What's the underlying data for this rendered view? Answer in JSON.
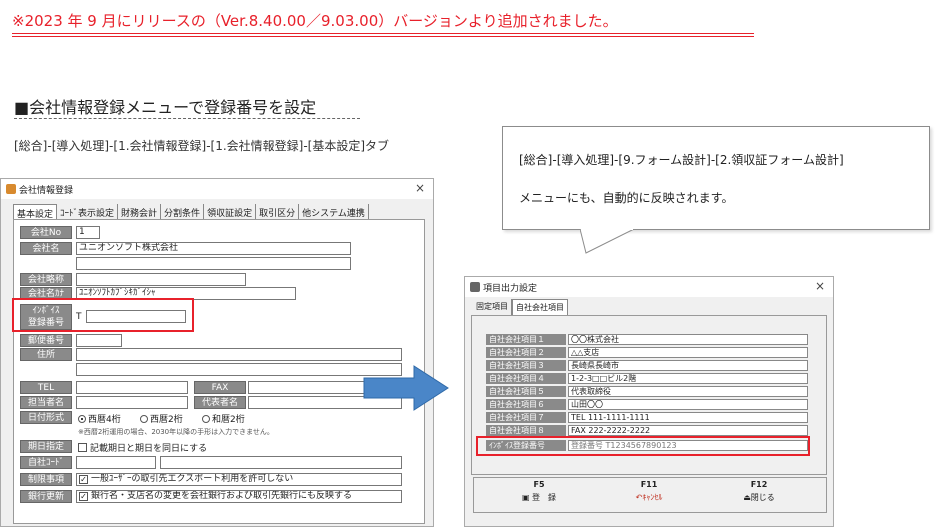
{
  "notice": "※2023 年 9 月にリリースの（Ver.8.40.00／9.03.00）バージョンより追加されました。",
  "section_title": "■会社情報登録メニューで登録番号を設定",
  "menu_path": "[総合]-[導入処理]-[1.会社情報登録]-[1.会社情報登録]-[基本設定]タブ",
  "callout": {
    "line1": "[総合]-[導入処理]-[9.フォーム設計]-[2.領収証フォーム設計]",
    "line2": "メニューにも、自動的に反映されます。"
  },
  "colors": {
    "notice_red": "#e8212b",
    "arrow_blue": "#4a86c8",
    "label_gray": "#8a8a8a"
  },
  "dialog1": {
    "title": "会社情報登録",
    "close": "×",
    "tabs": [
      "基本設定",
      "ｺｰﾄﾞ表示設定",
      "財務会計",
      "分割条件",
      "領収証設定",
      "取引区分",
      "他システム連携"
    ],
    "labels": {
      "company_no": "会社No",
      "company_name": "会社名",
      "company_short": "会社略称",
      "company_kana": "会社名ｶﾅ",
      "invoice_line1": "ｲﾝﾎﾞｲｽ",
      "invoice_line2": "登録番号",
      "postal": "郵便番号",
      "address": "住所",
      "tel": "TEL",
      "fax": "FAX",
      "contact_name": "担当者名",
      "representative": "代表者名",
      "date_format": "日付形式",
      "fiscal_date": "期日指定",
      "own_code": "自社ｺｰﾄﾞ",
      "restriction": "制限事項",
      "bank_update": "銀行更新"
    },
    "values": {
      "company_no": "1",
      "company_name": "ユニオンソフト株式会社",
      "company_kana": "ﾕﾆｵﾝｿﾌﾄｶﾌﾞｼｷｶﾞｲｼｬ",
      "invoice_prefix": "T",
      "date_opt1": "西暦4桁",
      "date_opt2": "西暦2桁",
      "date_opt3": "和暦2桁",
      "date_note": "※西暦2桁運用の場合、2030年以降の手形は入力できません。",
      "fiscal_check": "記載期日と期日を同日にする",
      "restriction_check": "一般ﾕｰｻﾞｰの取引先エクスポート利用を許可しない",
      "bank_check": "銀行名・支店名の変更を会社銀行および取引先銀行にも反映する"
    }
  },
  "dialog2": {
    "title": "項目出力設定",
    "close": "×",
    "tabs": [
      "固定項目",
      "自社会社項目"
    ],
    "rows": [
      {
        "label": "自社会社項目１",
        "value": "〇〇株式会社"
      },
      {
        "label": "自社会社項目２",
        "value": "△△支店"
      },
      {
        "label": "自社会社項目３",
        "value": "長崎県長崎市"
      },
      {
        "label": "自社会社項目４",
        "value": "1-2-3□□ビル2階"
      },
      {
        "label": "自社会社項目５",
        "value": "代表取締役"
      },
      {
        "label": "自社会社項目６",
        "value": "山田〇〇"
      },
      {
        "label": "自社会社項目７",
        "value": "TEL 111-1111-1111"
      },
      {
        "label": "自社会社項目８",
        "value": "FAX 222-2222-2222"
      },
      {
        "label": "ｲﾝﾎﾞｲｽ登録番号",
        "value": "登録番号 T1234567890123"
      }
    ],
    "fkeys": [
      {
        "key": "F5",
        "label": "登　録"
      },
      {
        "key": "F11",
        "label": "ｷｬﾝｾﾙ"
      },
      {
        "key": "F12",
        "label": "閉じる"
      }
    ]
  }
}
